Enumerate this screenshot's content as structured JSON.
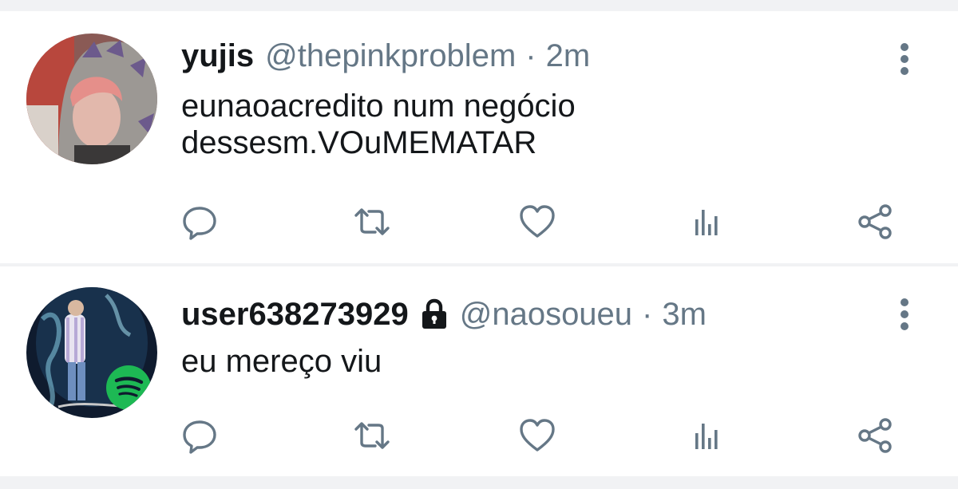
{
  "colors": {
    "muted": "#657786",
    "text": "#14171a",
    "background": "#ffffff",
    "divider": "#f1f2f4"
  },
  "tweets": [
    {
      "display_name": "yujis",
      "handle": "@thepinkproblem",
      "separator": "·",
      "time": "2m",
      "text_lines": [
        "eunaoacredito num negócio",
        "dessesm.VOuMEMATAR"
      ],
      "protected": false,
      "actions": [
        "reply-icon",
        "retweet-icon",
        "like-icon",
        "analytics-icon",
        "share-icon"
      ]
    },
    {
      "display_name": "user638273929",
      "handle": "@naosoueu",
      "separator": "·",
      "time": "3m",
      "text_lines": [
        "eu mereço viu"
      ],
      "protected": true,
      "actions": [
        "reply-icon",
        "retweet-icon",
        "like-icon",
        "analytics-icon",
        "share-icon"
      ]
    }
  ]
}
